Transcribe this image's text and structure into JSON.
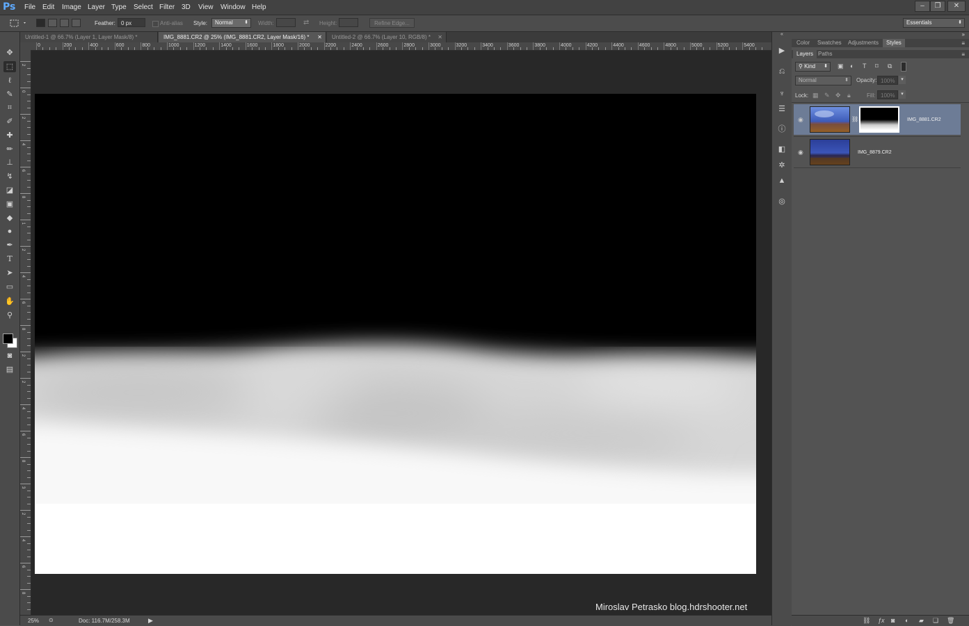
{
  "app": {
    "logo": "Ps"
  },
  "menu": [
    "File",
    "Edit",
    "Image",
    "Layer",
    "Type",
    "Select",
    "Filter",
    "3D",
    "View",
    "Window",
    "Help"
  ],
  "window_controls": {
    "minimize": "–",
    "restore": "❐",
    "close": "✕"
  },
  "options_bar": {
    "feather_label": "Feather:",
    "feather_value": "0 px",
    "antialias_label": "Anti-alias",
    "style_label": "Style:",
    "style_value": "Normal",
    "width_label": "Width:",
    "height_label": "Height:",
    "refine_edge": "Refine Edge...",
    "workspace": "Essentials"
  },
  "tabs": [
    {
      "label": "Untitled-1 @ 66.7% (Layer 1, Layer Mask/8) *",
      "active": false
    },
    {
      "label": "IMG_8881.CR2 @ 25% (IMG_8881.CR2, Layer Mask/16) *",
      "active": true
    },
    {
      "label": "Untitled-2 @ 66.7% (Layer 10, RGB/8) *",
      "active": false
    }
  ],
  "ruler_top_labels": [
    "0",
    "200",
    "400",
    "600",
    "800",
    "1000",
    "1200",
    "1400",
    "1600",
    "1800",
    "2000",
    "2200",
    "2400",
    "2600",
    "2800",
    "3000",
    "3200",
    "3400",
    "3600",
    "3800",
    "4000",
    "4200",
    "4400",
    "4600",
    "4800",
    "5000",
    "5200",
    "5400"
  ],
  "ruler_left_labels": [
    "2",
    "0",
    "2",
    "4",
    "6",
    "8",
    "1",
    "2",
    "4",
    "6",
    "8",
    "2",
    "2",
    "4",
    "6",
    "8",
    "3",
    "2",
    "4",
    "6",
    "8"
  ],
  "watermark": "Miroslav  Petrasko  blog.hdrshooter.net",
  "status": {
    "zoom": "25%",
    "doc": "Doc: 116.7M/258.3M"
  },
  "panels": {
    "top_tabs": [
      "Color",
      "Swatches",
      "Adjustments",
      "Styles"
    ],
    "layer_tabs": [
      "Layers",
      "Paths"
    ],
    "kind_label": "Kind",
    "blend_mode": "Normal",
    "opacity_label": "Opacity:",
    "opacity_value": "100%",
    "lock_label": "Lock:",
    "fill_label": "Fill:",
    "fill_value": "100%",
    "layers": [
      {
        "name": "IMG_8881.CR2",
        "has_mask": true,
        "selected": true
      },
      {
        "name": "IMG_8879.CR2",
        "has_mask": false,
        "selected": false
      }
    ]
  },
  "colors": {
    "accent_blue": "#5eaaff",
    "selected_layer": "#6d7c96"
  }
}
